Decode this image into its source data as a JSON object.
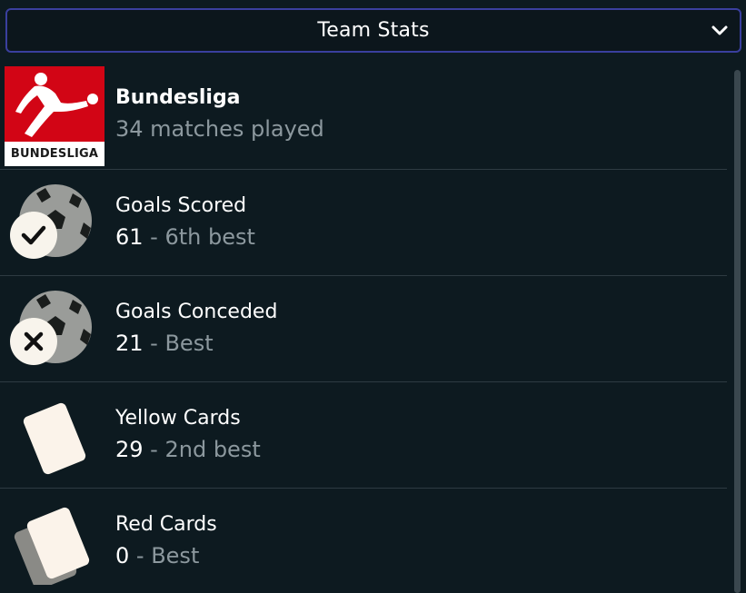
{
  "header": {
    "title": "Team Stats"
  },
  "league": {
    "name": "Bundesliga",
    "subtitle": "34 matches played",
    "logo_text": "BUNDESLIGA"
  },
  "stats": [
    {
      "label": "Goals Scored",
      "value": "61",
      "separator": " - ",
      "rank": "6th best",
      "icon": "football-check-icon"
    },
    {
      "label": "Goals Conceded",
      "value": "21",
      "separator": " - ",
      "rank": "Best",
      "icon": "football-x-icon"
    },
    {
      "label": "Yellow Cards",
      "value": "29",
      "separator": " - ",
      "rank": "2nd best",
      "icon": "yellow-card-icon"
    },
    {
      "label": "Red Cards",
      "value": "0",
      "separator": " - ",
      "rank": "Best",
      "icon": "red-card-icon"
    }
  ],
  "colors": {
    "background": "#0d1a20",
    "accent_border": "#3a3f9e",
    "muted_text": "#8c989e",
    "league_red": "#d20515"
  }
}
